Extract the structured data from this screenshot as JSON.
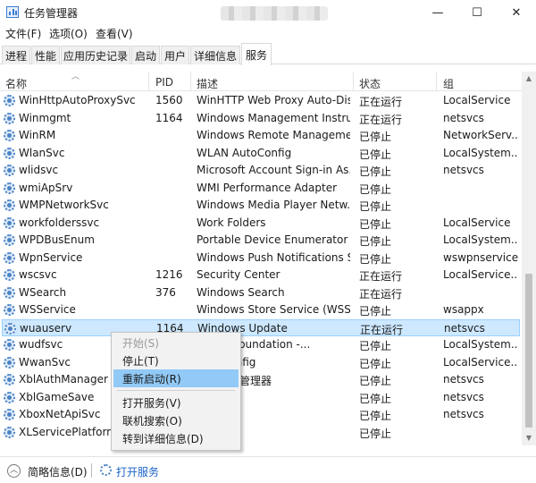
{
  "window": {
    "title": "任务管理器",
    "controls": {
      "minimize": "—",
      "maximize": "☐",
      "close": "✕"
    }
  },
  "menubar": [
    "文件(F)",
    "选项(O)",
    "查看(V)"
  ],
  "tabs": [
    "进程",
    "性能",
    "应用历史记录",
    "启动",
    "用户",
    "详细信息",
    "服务"
  ],
  "active_tab": "服务",
  "columns": {
    "name": "名称",
    "pid": "PID",
    "description": "描述",
    "status": "状态",
    "group": "组"
  },
  "rows": [
    {
      "name": "WinHttpAutoProxySvc",
      "pid": "1560",
      "description": "WinHTTP Web Proxy Auto-Dis...",
      "status": "正在运行",
      "group": "LocalService"
    },
    {
      "name": "Winmgmt",
      "pid": "1164",
      "description": "Windows Management Instru...",
      "status": "正在运行",
      "group": "netsvcs"
    },
    {
      "name": "WinRM",
      "pid": "",
      "description": "Windows Remote Manageme...",
      "status": "已停止",
      "group": "NetworkServ..."
    },
    {
      "name": "WlanSvc",
      "pid": "",
      "description": "WLAN AutoConfig",
      "status": "已停止",
      "group": "LocalSystem..."
    },
    {
      "name": "wlidsvc",
      "pid": "",
      "description": "Microsoft Account Sign-in As...",
      "status": "已停止",
      "group": "netsvcs"
    },
    {
      "name": "wmiApSrv",
      "pid": "",
      "description": "WMI Performance Adapter",
      "status": "已停止",
      "group": ""
    },
    {
      "name": "WMPNetworkSvc",
      "pid": "",
      "description": "Windows Media Player Netw...",
      "status": "已停止",
      "group": ""
    },
    {
      "name": "workfolderssvc",
      "pid": "",
      "description": "Work Folders",
      "status": "已停止",
      "group": "LocalService"
    },
    {
      "name": "WPDBusEnum",
      "pid": "",
      "description": "Portable Device Enumerator ...",
      "status": "已停止",
      "group": "LocalSystem..."
    },
    {
      "name": "WpnService",
      "pid": "",
      "description": "Windows Push Notifications S...",
      "status": "已停止",
      "group": "wswpnservice"
    },
    {
      "name": "wscsvc",
      "pid": "1216",
      "description": "Security Center",
      "status": "正在运行",
      "group": "LocalService..."
    },
    {
      "name": "WSearch",
      "pid": "376",
      "description": "Windows Search",
      "status": "正在运行",
      "group": ""
    },
    {
      "name": "WSService",
      "pid": "",
      "description": "Windows Store Service (WSS...",
      "status": "已停止",
      "group": "wsappx"
    },
    {
      "name": "wuauserv",
      "pid": "1164",
      "description": "Windows Update",
      "status": "正在运行",
      "group": "netsvcs"
    },
    {
      "name": "wudfsvc",
      "pid": "",
      "description": "Driver Foundation -...",
      "status": "已停止",
      "group": "LocalSystem..."
    },
    {
      "name": "WwanSvc",
      "pid": "",
      "description": "AutoConfig",
      "status": "已停止",
      "group": "LocalService..."
    },
    {
      "name": "XblAuthManager",
      "pid": "",
      "description": "身份验证管理器",
      "status": "已停止",
      "group": "netsvcs"
    },
    {
      "name": "XblGameSave",
      "pid": "",
      "description": "游戏保存",
      "status": "已停止",
      "group": "netsvcs"
    },
    {
      "name": "XboxNetApiSvc",
      "pid": "",
      "description": "网络服务",
      "status": "已停止",
      "group": "netsvcs"
    },
    {
      "name": "XLServicePlatform",
      "pid": "",
      "description": "Platform",
      "status": "已停止",
      "group": ""
    }
  ],
  "selected_row": "wuauserv",
  "context_menu": {
    "items": [
      {
        "label": "开始(S)",
        "state": "disabled"
      },
      {
        "label": "停止(T)",
        "state": "normal"
      },
      {
        "label": "重新启动(R)",
        "state": "hover"
      },
      {
        "label": "打开服务(V)",
        "state": "normal"
      },
      {
        "label": "联机搜索(O)",
        "state": "normal"
      },
      {
        "label": "转到详细信息(D)",
        "state": "normal"
      }
    ]
  },
  "statusbar": {
    "brief": "简略信息(D)",
    "open_services": "打开服务"
  },
  "icons": {
    "app": "task-manager-icon",
    "service": "gear-icon",
    "sort": "sort-up-icon",
    "collapse": "chevron-up-icon"
  },
  "colors": {
    "selected_row": "#cde8ff",
    "menu_hover": "#91c9f7",
    "link": "#1a64c8"
  }
}
